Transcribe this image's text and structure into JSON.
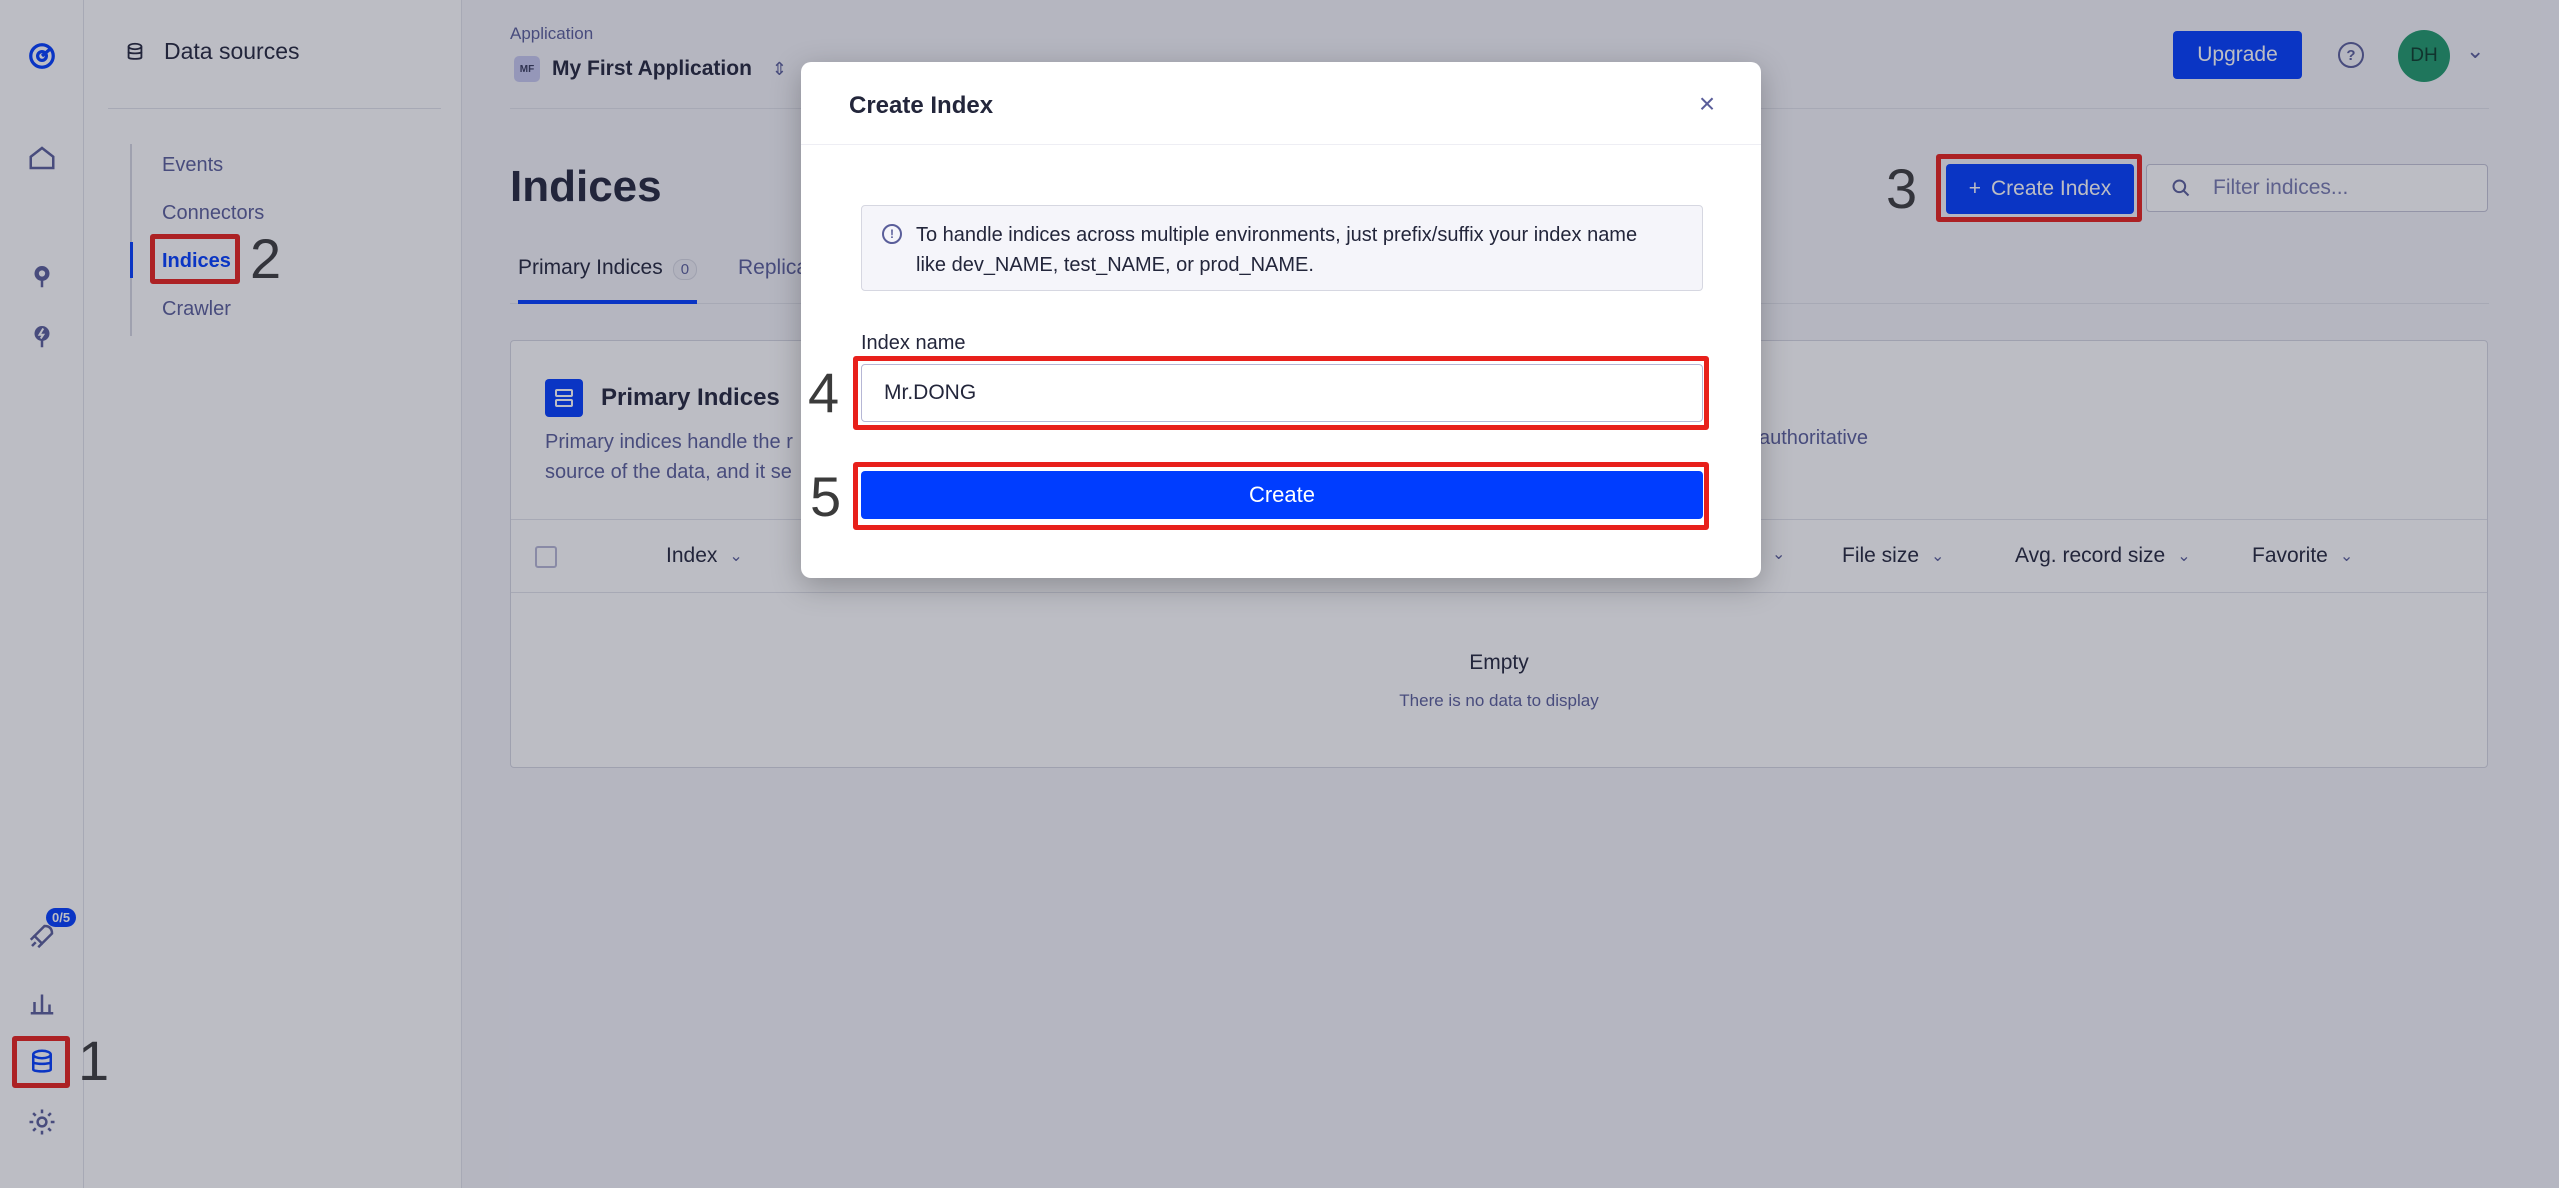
{
  "rail": {
    "onboarding_badge": "0/5"
  },
  "sidebar": {
    "title": "Data sources",
    "items": [
      {
        "label": "Events"
      },
      {
        "label": "Connectors"
      },
      {
        "label": "Indices"
      },
      {
        "label": "Crawler"
      }
    ]
  },
  "header": {
    "app_label": "Application",
    "app_avatar": "MF",
    "app_name": "My First Application",
    "upgrade_label": "Upgrade",
    "help_glyph": "?",
    "user_initials": "DH"
  },
  "main": {
    "title": "Indices",
    "create_index_label": "Create Index",
    "filter_placeholder": "Filter indices...",
    "tabs": [
      {
        "label": "Primary Indices",
        "count": "0"
      },
      {
        "label": "Replica"
      }
    ],
    "card": {
      "title": "Primary Indices",
      "desc_line1": "Primary indices handle the r",
      "desc_line2": "source of the data, and it se",
      "desc_right": "authoritative",
      "columns": [
        "Index",
        "File size",
        "Avg. record size",
        "Favorite"
      ],
      "empty_title": "Empty",
      "empty_sub": "There is no data to display"
    }
  },
  "modal": {
    "title": "Create Index",
    "close_glyph": "×",
    "info_line1": "To handle indices across multiple environments, just prefix/suffix your index name",
    "info_line2": "like dev_NAME, test_NAME, or prod_NAME.",
    "field_label": "Index name",
    "field_value": "Mr.DONG",
    "create_label": "Create"
  },
  "annotations": [
    "1",
    "2",
    "3",
    "4",
    "5"
  ],
  "colors": {
    "accent": "#003dff",
    "annotation_red": "#e8201b",
    "avatar_green": "#1f9a6a"
  }
}
